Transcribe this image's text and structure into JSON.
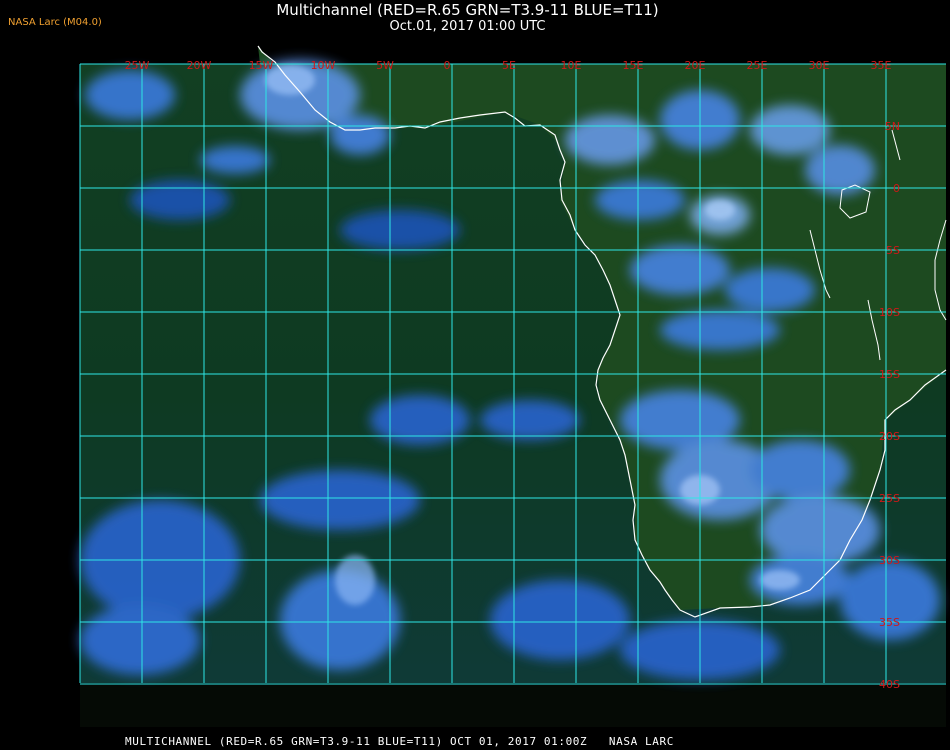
{
  "header": {
    "title": "Multichannel (RED=R.65 GRN=T3.9-11 BLUE=T11)",
    "datetime": "Oct.01, 2017 01:00 UTC",
    "producer": "NASA Larc (M04.0)"
  },
  "map": {
    "grid_color": "#2ee6e6",
    "label_color": "#d01818",
    "land_color": "#1e4a22",
    "ocean_color": "#0c3a1a",
    "cloud_color": "#3a78e8",
    "coastline_color": "#ffffff",
    "longitude_labels": [
      "25W",
      "20W",
      "15W",
      "10W",
      "5W",
      "0",
      "5E",
      "10E",
      "15E",
      "20E",
      "25E",
      "30E",
      "35E"
    ],
    "latitude_labels": [
      "5N",
      "0",
      "5S",
      "10S",
      "15S",
      "20S",
      "25S",
      "30S",
      "35S",
      "40S"
    ]
  },
  "footer": {
    "text": "MULTICHANNEL (RED=R.65 GRN=T3.9-11 BLUE=T11) OCT 01, 2017 01:00Z   NASA LARC"
  }
}
